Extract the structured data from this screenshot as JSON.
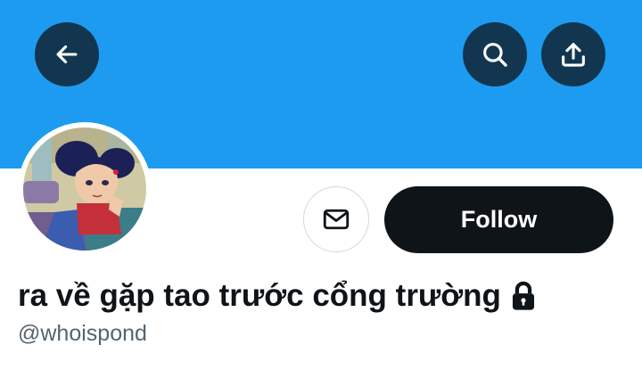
{
  "header": {
    "back_icon": "arrow-left-icon",
    "search_icon": "search-icon",
    "share_icon": "share-upload-icon",
    "banner_color": "#1d9bf0"
  },
  "profile": {
    "avatar_icon": "cartoon-girl-avatar",
    "message_icon": "envelope-icon",
    "follow_label": "Follow",
    "display_name": "ra về gặp tao trước cổng trường",
    "protected_icon": "lock-icon",
    "handle": "@whoispond"
  }
}
